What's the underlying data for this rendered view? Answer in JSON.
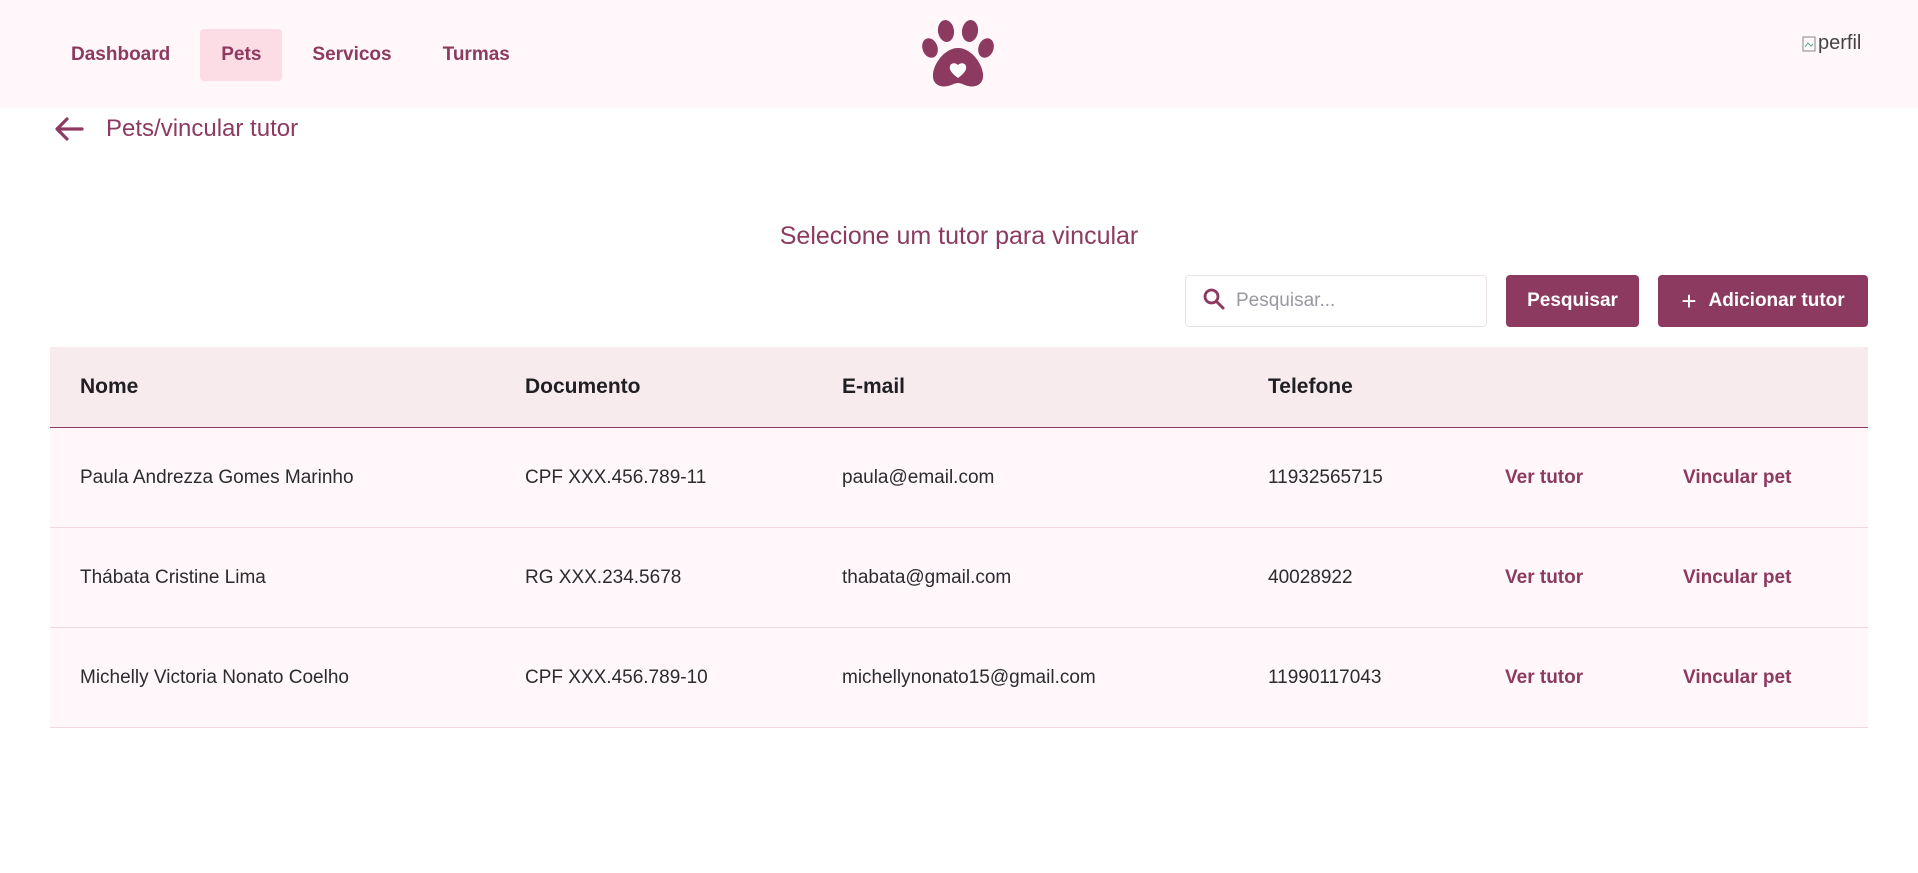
{
  "nav": {
    "items": [
      {
        "label": "Dashboard",
        "active": false
      },
      {
        "label": "Pets",
        "active": true
      },
      {
        "label": "Servicos",
        "active": false
      },
      {
        "label": "Turmas",
        "active": false
      }
    ]
  },
  "header": {
    "avatar_alt": "perfil"
  },
  "breadcrumb": {
    "text": "Pets/vincular tutor"
  },
  "main": {
    "heading": "Selecione um tutor para vincular",
    "search_placeholder": "Pesquisar...",
    "search_button": "Pesquisar",
    "add_button": "Adicionar tutor"
  },
  "table": {
    "headers": [
      "Nome",
      "Documento",
      "E-mail",
      "Telefone"
    ],
    "rows": [
      {
        "nome": "Paula Andrezza Gomes Marinho",
        "documento": "CPF XXX.456.789-11",
        "email": "paula@email.com",
        "telefone": "11932565715",
        "ver": "Ver tutor",
        "vincular": "Vincular pet"
      },
      {
        "nome": "Thábata Cristine Lima",
        "documento": "RG XXX.234.5678",
        "email": "thabata@gmail.com",
        "telefone": "40028922",
        "ver": "Ver tutor",
        "vincular": "Vincular pet"
      },
      {
        "nome": "Michelly Victoria Nonato Coelho",
        "documento": "CPF XXX.456.789-10",
        "email": "michellynonato15@gmail.com",
        "telefone": "11990117043",
        "ver": "Ver tutor",
        "vincular": "Vincular pet"
      }
    ]
  },
  "colors": {
    "accent": "#8d3a60",
    "nav_active_bg": "#fcdde6",
    "header_bg": "#fff7fa",
    "table_head_bg": "#f7ebed"
  },
  "icons": {
    "logo": "paw-heart-icon",
    "back": "arrow-left-icon",
    "search": "search-icon",
    "add": "plus-icon"
  }
}
